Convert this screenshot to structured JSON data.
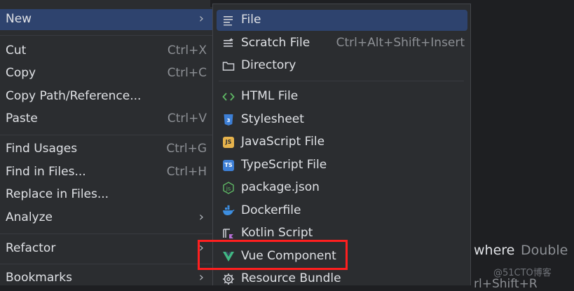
{
  "editor": {
    "partial_top_text": "",
    "hint_where": "where",
    "hint_double": "Double",
    "hint_shortcut": "rl+Shift+R",
    "watermark": "@51CTO博客"
  },
  "left_menu": {
    "items": [
      {
        "label": "New",
        "shortcut": "",
        "arrow": "›"
      },
      {
        "label": "Cut",
        "shortcut": "Ctrl+X"
      },
      {
        "label": "Copy",
        "shortcut": "Ctrl+C"
      },
      {
        "label": "Copy Path/Reference...",
        "shortcut": ""
      },
      {
        "label": "Paste",
        "shortcut": "Ctrl+V"
      },
      {
        "label": "Find Usages",
        "shortcut": "Ctrl+G"
      },
      {
        "label": "Find in Files...",
        "shortcut": "Ctrl+H"
      },
      {
        "label": "Replace in Files...",
        "shortcut": ""
      },
      {
        "label": "Analyze",
        "shortcut": "",
        "arrow": "›"
      },
      {
        "label": "Refactor",
        "shortcut": "",
        "arrow": "›"
      },
      {
        "label": "Bookmarks",
        "shortcut": "",
        "arrow": "›"
      }
    ]
  },
  "new_submenu": {
    "items": [
      {
        "label": "File",
        "shortcut": "",
        "icon": "file-lines-icon"
      },
      {
        "label": "Scratch File",
        "shortcut": "Ctrl+Alt+Shift+Insert",
        "icon": "scratch-file-icon"
      },
      {
        "label": "Directory",
        "shortcut": "",
        "icon": "folder-icon"
      },
      {
        "label": "HTML File",
        "shortcut": "",
        "icon": "html-icon"
      },
      {
        "label": "Stylesheet",
        "shortcut": "",
        "icon": "css-icon"
      },
      {
        "label": "JavaScript File",
        "shortcut": "",
        "icon": "javascript-icon",
        "badge": "JS"
      },
      {
        "label": "TypeScript File",
        "shortcut": "",
        "icon": "typescript-icon",
        "badge": "TS"
      },
      {
        "label": "package.json",
        "shortcut": "",
        "icon": "nodejs-icon"
      },
      {
        "label": "Dockerfile",
        "shortcut": "",
        "icon": "docker-icon"
      },
      {
        "label": "Kotlin Script",
        "shortcut": "",
        "icon": "kotlin-script-icon"
      },
      {
        "label": "Vue Component",
        "shortcut": "",
        "icon": "vue-icon"
      },
      {
        "label": "Resource Bundle",
        "shortcut": "",
        "icon": "gear-icon"
      }
    ]
  },
  "colors": {
    "menu_bg": "#2b2d30",
    "selection": "#2e436e",
    "highlight_box": "#ff1f1f",
    "vue_green": "#41b883",
    "css_blue": "#3d7fd6"
  }
}
